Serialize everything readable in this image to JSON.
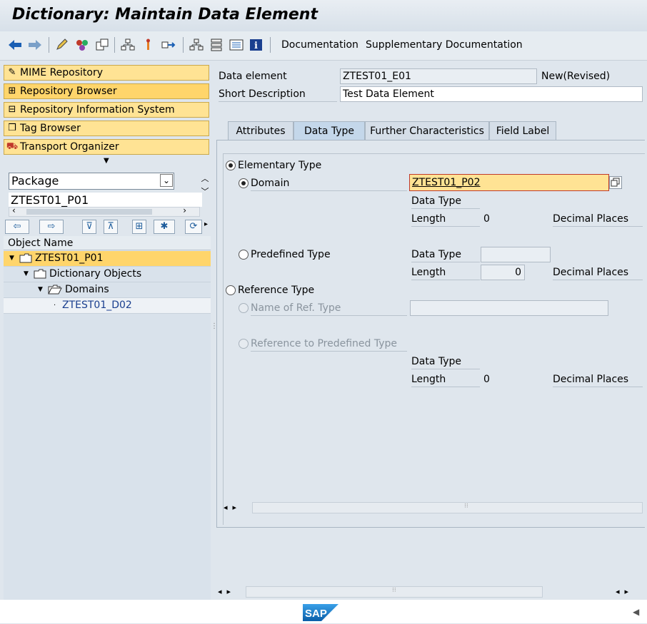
{
  "window": {
    "title": "Dictionary: Maintain Data Element"
  },
  "toolbar": {
    "documentation_label": "Documentation",
    "supplementary_label": "Supplementary Documentation"
  },
  "nav": {
    "items": [
      {
        "label": "MIME Repository"
      },
      {
        "label": "Repository Browser"
      },
      {
        "label": "Repository Information System"
      },
      {
        "label": "Tag Browser"
      },
      {
        "label": "Transport Organizer"
      }
    ],
    "package_select": "Package",
    "package_value": "ZTEST01_P01"
  },
  "tree": {
    "header": "Object Name",
    "rows": [
      {
        "label": "ZTEST01_P01"
      },
      {
        "label": "Dictionary Objects"
      },
      {
        "label": "Domains"
      },
      {
        "label": "ZTEST01_D02"
      }
    ]
  },
  "header": {
    "data_element_label": "Data element",
    "data_element_value": "ZTEST01_E01",
    "status": "New(Revised)",
    "short_desc_label": "Short Description",
    "short_desc_value": "Test Data Element"
  },
  "tabs": [
    {
      "label": "Attributes"
    },
    {
      "label": "Data Type"
    },
    {
      "label": "Further Characteristics"
    },
    {
      "label": "Field Label"
    }
  ],
  "datatype": {
    "elementary_label": "Elementary Type",
    "domain_label": "Domain",
    "domain_value": "ZTEST01_P02",
    "data_type_label": "Data Type",
    "length_label": "Length",
    "length_value": "0",
    "decimal_label": "Decimal Places",
    "predefined_label": "Predefined Type",
    "predef_data_type_label": "Data Type",
    "predef_length_label": "Length",
    "predef_length_value": "0",
    "predef_decimal_label": "Decimal Places",
    "reference_label": "Reference Type",
    "name_ref_label": "Name of Ref. Type",
    "ref_predef_label": "Reference to Predefined Type",
    "ref_data_type_label": "Data Type",
    "ref_length_label": "Length",
    "ref_length_value": "0",
    "ref_decimal_label": "Decimal Places"
  },
  "footer": {
    "logo": "SAP"
  },
  "colors": {
    "accent": "#ffe394",
    "selected_row": "#ffd56b",
    "background": "#dfe6ed"
  }
}
